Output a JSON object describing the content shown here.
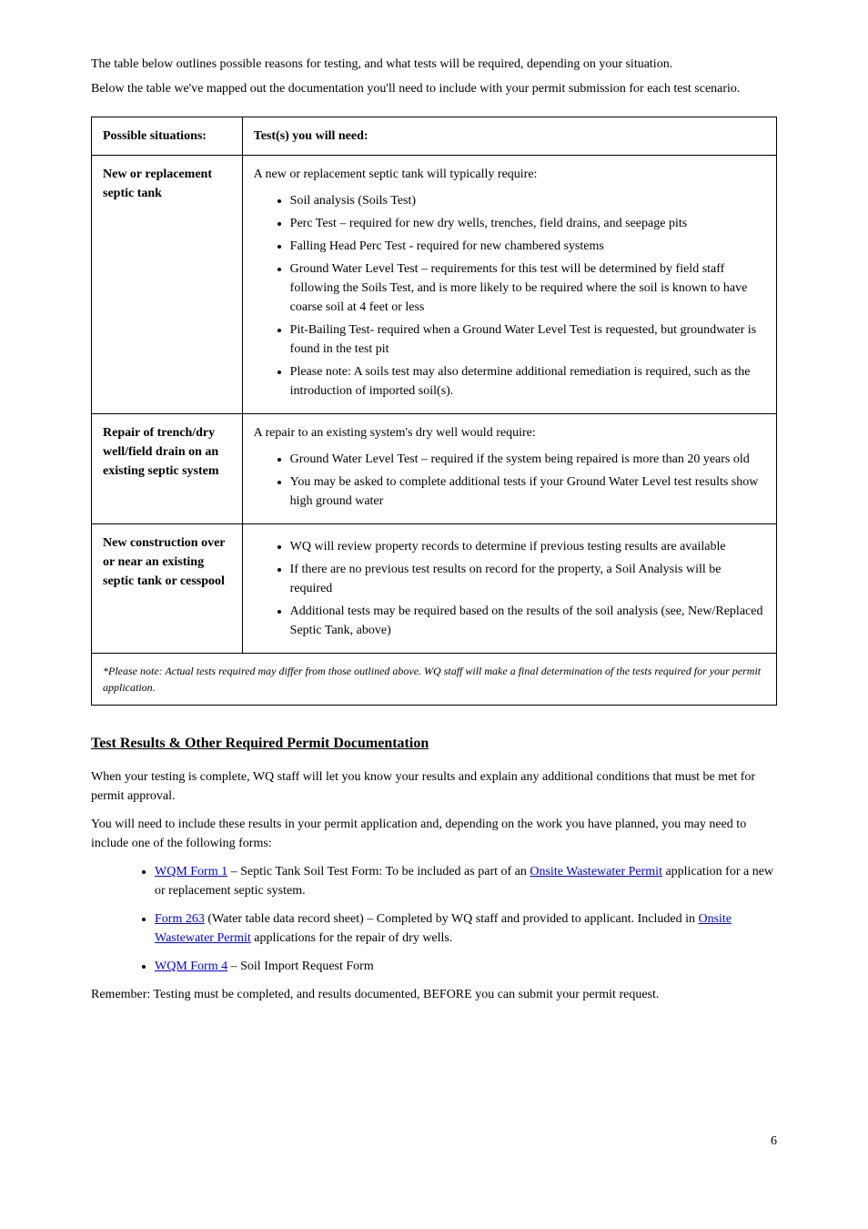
{
  "intro": {
    "p1": "The table below outlines possible reasons for testing, and what tests will be required, depending on your situation.",
    "p2": "Below the table we've mapped out the documentation you'll need to include with your permit submission for each test scenario."
  },
  "table": {
    "header_left": "Possible situations:",
    "header_right": "Test(s) you will need:",
    "rows": [
      {
        "left": "New or replacement septic tank",
        "right_intro": "A new or replacement septic tank will typically require:",
        "items": [
          "Soil analysis (Soils Test)",
          "Perc Test – required for new dry wells, trenches, field drains, and seepage pits",
          "Falling Head Perc Test - required for new chambered systems",
          "Ground Water Level Test – requirements for this test will be determined by field staff following the Soils Test, and is more likely to be required where the soil is known to have coarse soil at 4 feet or less",
          "Pit-Bailing Test- required when a Ground Water Level Test is requested, but groundwater is found in the test pit",
          "Please note: A soils test may also determine additional remediation is required, such as the introduction of imported soil(s)."
        ]
      },
      {
        "left": "Repair of trench/dry well/field drain on an existing septic system",
        "right_intro": "A repair to an existing system's dry well would require:",
        "items": [
          "Ground Water Level Test – required if the system being repaired is more than 20 years old",
          "You may be asked to complete additional tests if your Ground Water Level test results show high ground water"
        ]
      },
      {
        "left": "New construction over or near an existing septic tank or cesspool",
        "right_intro": "",
        "items": [
          "WQ will review property records to determine if previous testing results are available",
          "If there are no previous test results on record for the property, a Soil Analysis will be required",
          "Additional tests may be required based on the results of the soil analysis (see, New/Replaced Septic Tank, above)"
        ]
      }
    ],
    "footnote": "*Please note: Actual tests required may differ from those outlined above. WQ staff will make a final determination of the tests required for your permit application."
  },
  "section2": {
    "heading": "Test Results & Other Required Permit Documentation",
    "p1": "When your testing is complete, WQ staff will let you know your results and explain any additional conditions that must be met for permit approval.",
    "p2": "You will need to include these results in your permit application and, depending on the work you have planned, you may need to include one of the following forms:",
    "bullets": [
      {
        "link1_text": "WQM Form 1",
        "mid1": " – Septic Tank Soil Test Form: To be included as part of an ",
        "link2_text": "Onsite Wastewater Permit",
        "mid2": " application for a new or replacement septic system."
      },
      {
        "link1_text": "Form 263",
        "mid1": " (Water table data record sheet) – Completed by WQ staff and provided to applicant. Included in ",
        "link2_text": "Onsite Wastewater Permit",
        "mid2": " applications for the repair of dry wells."
      },
      {
        "link1_text": "WQM Form 4",
        "mid1": " – Soil Import Request Form",
        "link2_text": "",
        "mid2": ""
      }
    ],
    "p3": "Remember: Testing must be completed, and results documented, BEFORE you can submit your permit request."
  },
  "page_number": "6"
}
